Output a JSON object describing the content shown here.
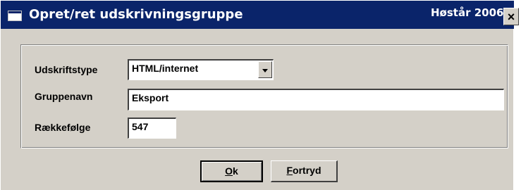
{
  "window": {
    "title": "Opret/ret udskrivningsgruppe",
    "season": "Høstår 2006",
    "close_label": "×"
  },
  "form": {
    "print_type": {
      "label": "Udskriftstype",
      "value": "HTML/internet"
    },
    "group_name": {
      "label": "Gruppenavn",
      "value": "Eksport"
    },
    "order": {
      "label": "Rækkefølge",
      "value": "547"
    }
  },
  "buttons": {
    "ok": {
      "mnemonic": "O",
      "rest": "k"
    },
    "cancel": {
      "mnemonic": "F",
      "rest": "ortryd"
    }
  }
}
